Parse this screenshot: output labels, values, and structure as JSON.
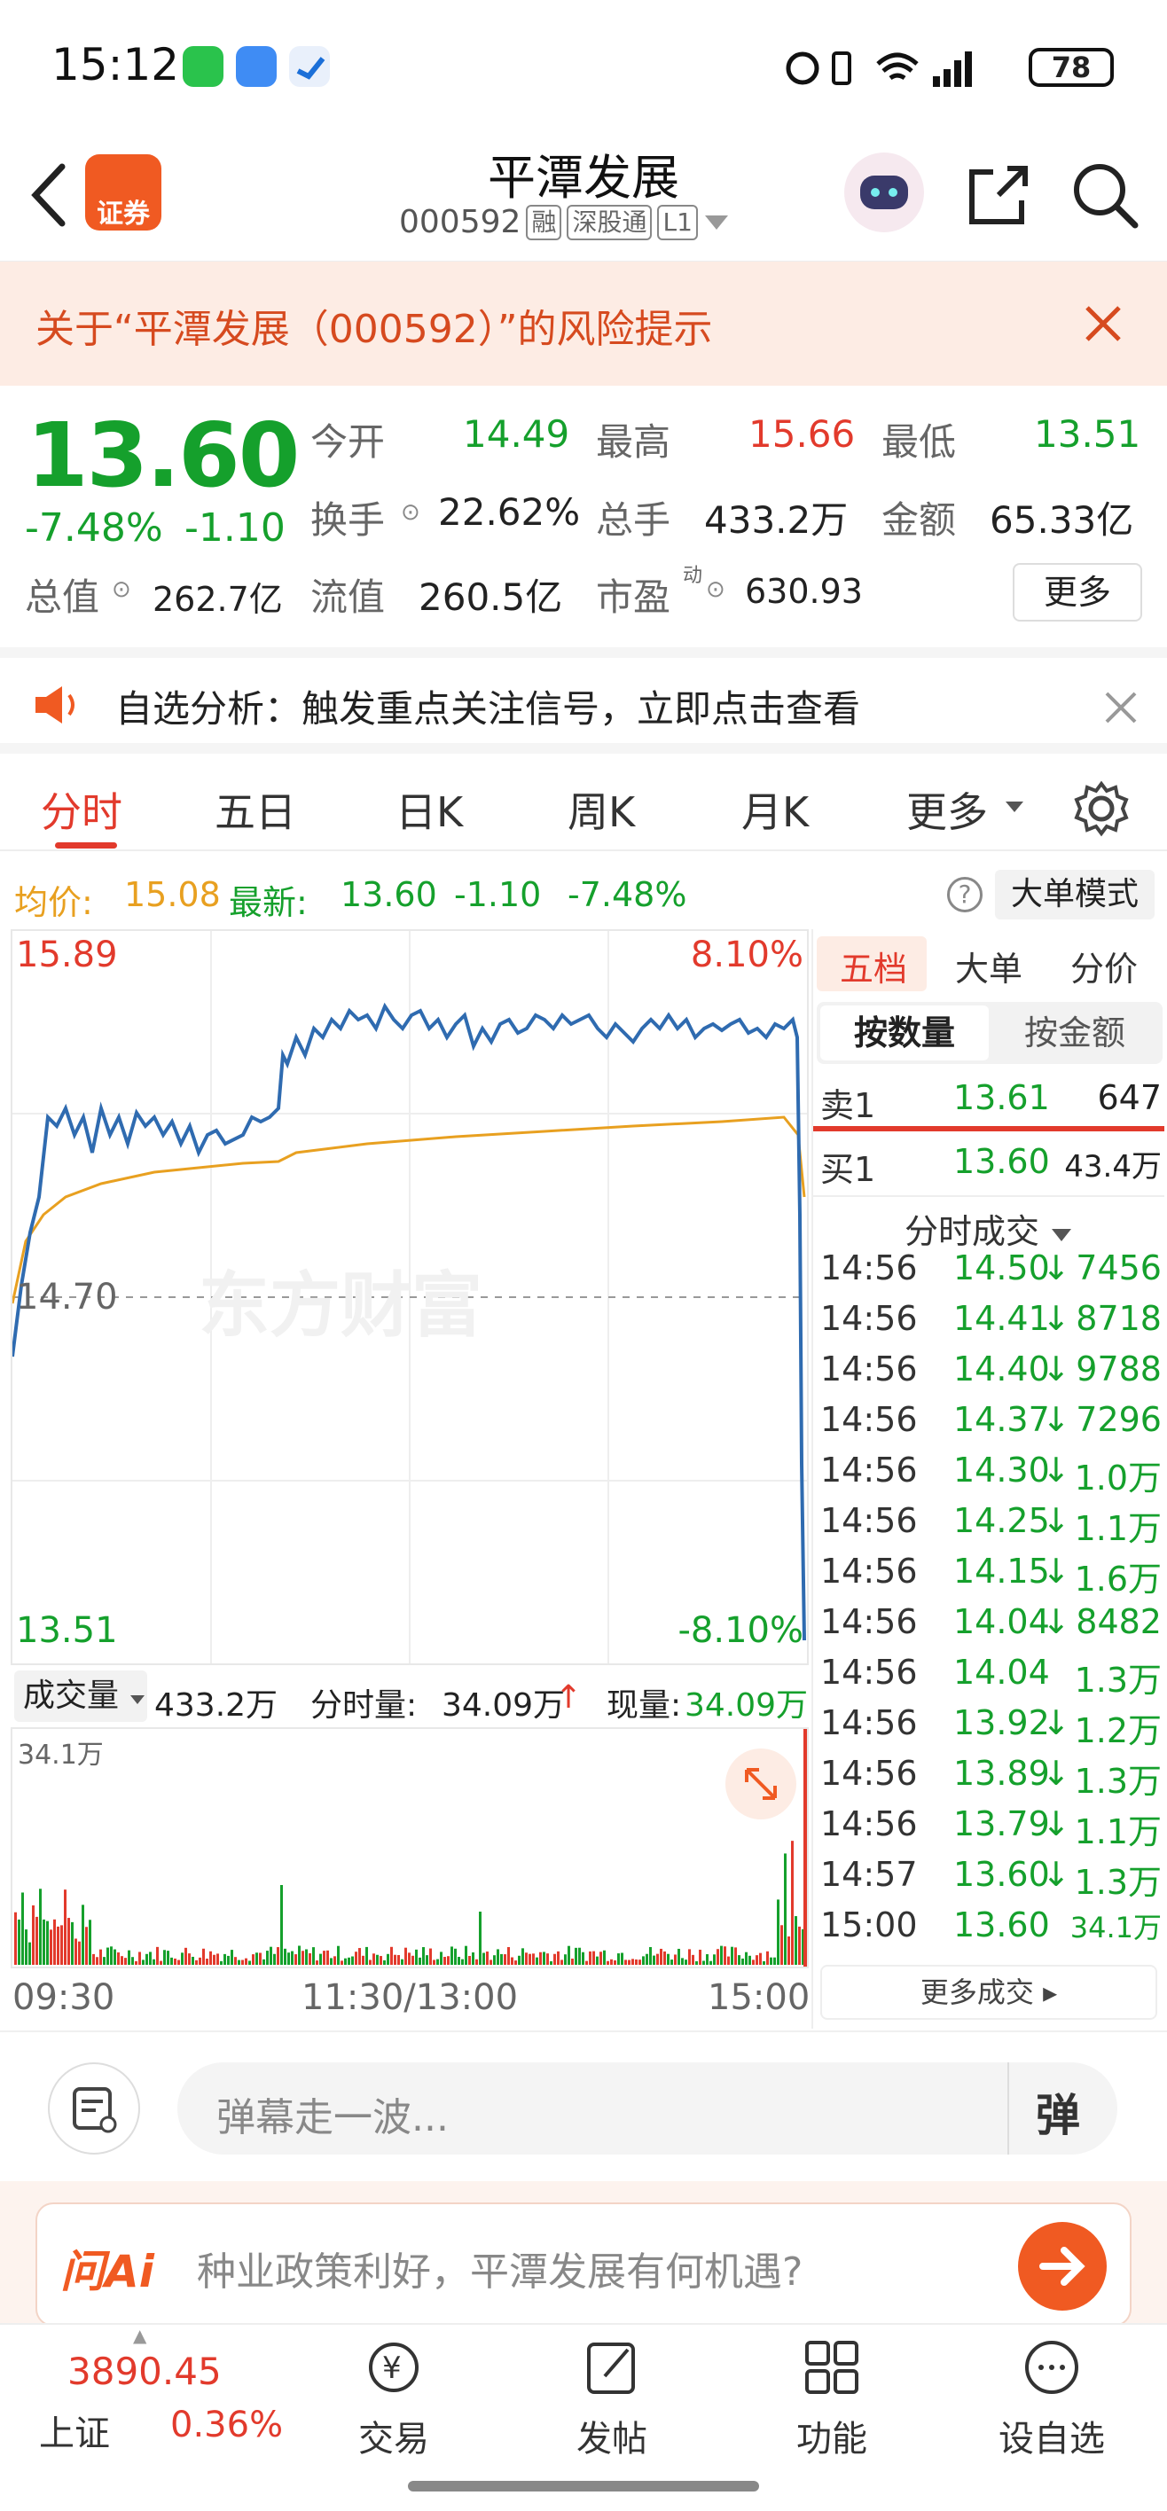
{
  "status_bar": {
    "time": "15:12",
    "battery": "78"
  },
  "header": {
    "title": "平潭发展",
    "code": "000592",
    "tags": [
      "融",
      "深股通",
      "L1"
    ],
    "broker_badge": "证券"
  },
  "risk_banner": {
    "text": "关于“平潭发展（000592）”的风险提示"
  },
  "quote": {
    "price": "13.60",
    "change_pct": "-7.48%",
    "change": "-1.10",
    "open_label": "今开",
    "open": "14.49",
    "high_label": "最高",
    "high": "15.66",
    "low_label": "最低",
    "low": "13.51",
    "turnover_label": "换手",
    "turnover": "22.62%",
    "volume_label": "总手",
    "volume": "433.2万",
    "amount_label": "金额",
    "amount": "65.33亿",
    "mktcap_label": "总值",
    "mktcap": "262.7亿",
    "float_label": "流值",
    "float": "260.5亿",
    "pe_label": "市盈",
    "pe_sup": "动",
    "pe": "630.93",
    "more_button": "更多"
  },
  "alert": {
    "text": "自选分析：触发重点关注信号，立即点击查看"
  },
  "tabs": [
    "分时",
    "五日",
    "日K",
    "周K",
    "月K",
    "更多"
  ],
  "avg_info": {
    "avg_label": "均价:",
    "avg": "15.08",
    "latest_label": "最新:",
    "latest": "13.60",
    "change": "-1.10",
    "change_pct": "-7.48%",
    "mode_button": "大单模式"
  },
  "chart": {
    "price_high": "15.89",
    "pct_high": "8.10%",
    "price_mid": "14.70",
    "price_low": "13.51",
    "pct_low": "-8.10%",
    "vol_label": "成交量",
    "vol_total": "433.2万",
    "minute_vol_label": "分时量:",
    "minute_vol": "34.09万",
    "current_vol_label": "现量:",
    "current_vol": "34.09万",
    "vol_max": "34.1万",
    "time_start": "09:30",
    "time_mid": "11:30/13:00",
    "time_end": "15:00",
    "watermark": "东方财富"
  },
  "right_panel": {
    "tabs": [
      "五档",
      "大单",
      "分价"
    ],
    "sub_tabs": [
      "按数量",
      "按金额"
    ],
    "sell1": {
      "label": "卖1",
      "price": "13.61",
      "vol": "647"
    },
    "buy1": {
      "label": "买1",
      "price": "13.60",
      "vol": "43.4万"
    },
    "trades_title": "分时成交",
    "trades": [
      {
        "time": "14:56",
        "price": "14.50",
        "vol": "7456",
        "arrow": "↓"
      },
      {
        "time": "14:56",
        "price": "14.41",
        "vol": "8718",
        "arrow": "↓"
      },
      {
        "time": "14:56",
        "price": "14.40",
        "vol": "9788",
        "arrow": "↓"
      },
      {
        "time": "14:56",
        "price": "14.37",
        "vol": "7296",
        "arrow": "↓"
      },
      {
        "time": "14:56",
        "price": "14.30",
        "vol": "1.0万",
        "arrow": "↓"
      },
      {
        "time": "14:56",
        "price": "14.25",
        "vol": "1.1万",
        "arrow": "↓"
      },
      {
        "time": "14:56",
        "price": "14.15",
        "vol": "1.6万",
        "arrow": "↓"
      },
      {
        "time": "14:56",
        "price": "14.04",
        "vol": "8482",
        "arrow": "↓"
      },
      {
        "time": "14:56",
        "price": "14.04",
        "vol": "1.3万",
        "arrow": ""
      },
      {
        "time": "14:56",
        "price": "13.92",
        "vol": "1.2万",
        "arrow": "↓"
      },
      {
        "time": "14:56",
        "price": "13.89",
        "vol": "1.3万",
        "arrow": "↓"
      },
      {
        "time": "14:56",
        "price": "13.79",
        "vol": "1.1万",
        "arrow": "↓"
      },
      {
        "time": "14:57",
        "price": "13.60",
        "vol": "1.3万",
        "arrow": "↓"
      },
      {
        "time": "15:00",
        "price": "13.60",
        "vol": "34.1万",
        "arrow": ""
      }
    ],
    "more_trades": "更多成交"
  },
  "danmu": {
    "placeholder": "弹幕走一波...",
    "button": "弹"
  },
  "ask_ai": {
    "logo": "问Ai",
    "text": "种业政策利好，平潭发展有何机遇?"
  },
  "bottom_nav": {
    "index_value": "3890.45",
    "index_name": "上证",
    "index_change": "0.36%",
    "items": [
      "交易",
      "发帖",
      "功能",
      "设自选"
    ]
  },
  "colors": {
    "up": "#e23a2c",
    "down": "#15a02c",
    "avg_line": "#e8a020",
    "price_line": "#2f6bb0",
    "accent": "#f05a22"
  }
}
